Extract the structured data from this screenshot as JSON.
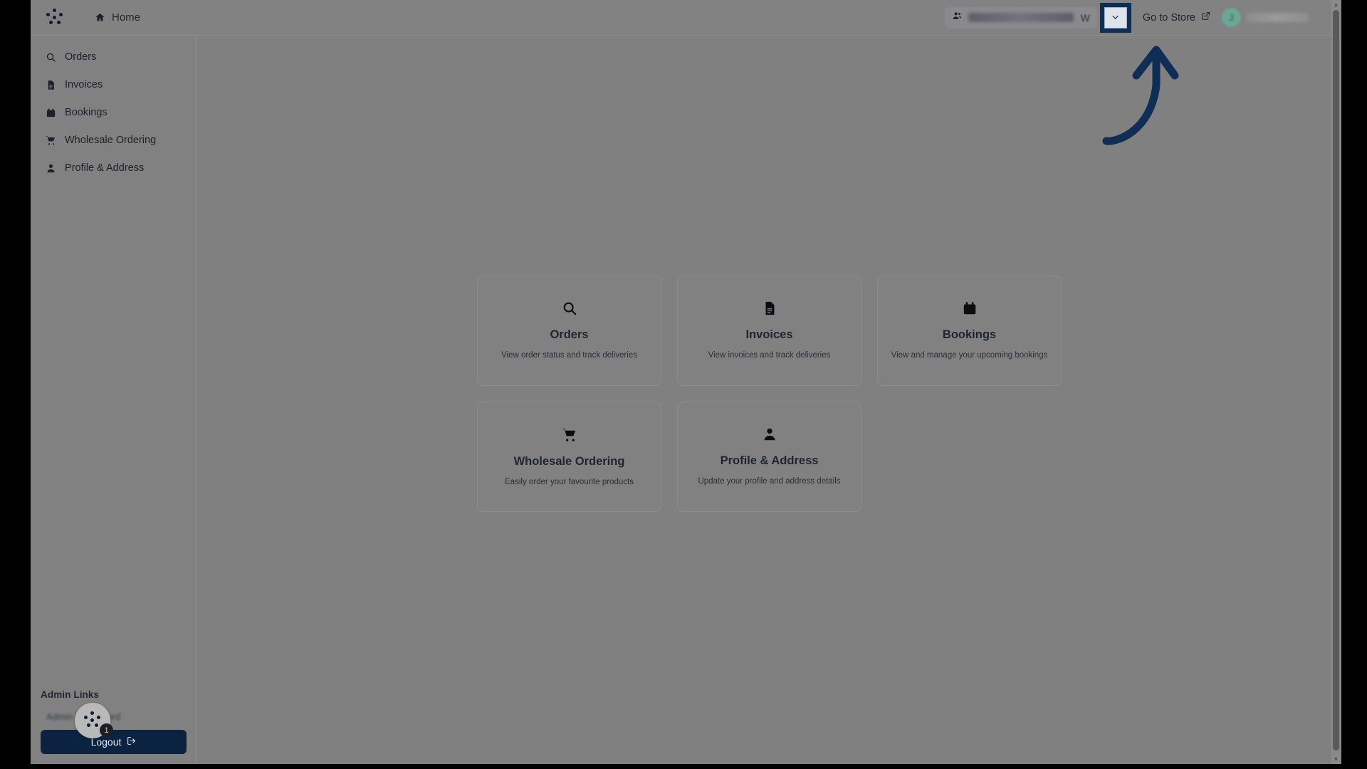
{
  "brand": {
    "logo_icon": "six-dot-logo"
  },
  "topbar": {
    "home_label": "Home",
    "home_icon": "home-icon",
    "customer_selector": {
      "icon": "users-icon",
      "value_redacted": "",
      "value_visible_fragment": "W",
      "dropdown_icon": "chevron-down-icon"
    },
    "store_link_label": "Go to Store",
    "store_link_icon": "external-link-icon",
    "avatar_initial": "J"
  },
  "sidebar": {
    "items": [
      {
        "label": "Orders",
        "icon": "search-icon"
      },
      {
        "label": "Invoices",
        "icon": "document-icon"
      },
      {
        "label": "Bookings",
        "icon": "calendar-icon"
      },
      {
        "label": "Wholesale Ordering",
        "icon": "cart-icon"
      },
      {
        "label": "Profile & Address",
        "icon": "person-icon"
      }
    ],
    "admin": {
      "title": "Admin Links",
      "hidden_link_text": "Admin Dashboard",
      "logout_label": "Logout",
      "logout_icon": "logout-icon"
    }
  },
  "launcher": {
    "icon": "six-dot-logo",
    "badge_count": "1"
  },
  "main": {
    "cards": [
      {
        "title": "Orders",
        "desc": "View order status and track deliveries",
        "icon": "search-icon"
      },
      {
        "title": "Invoices",
        "desc": "View invoices and track deliveries",
        "icon": "document-icon"
      },
      {
        "title": "Bookings",
        "desc": "View and manage your upcoming bookings",
        "icon": "calendar-icon"
      },
      {
        "title": "Wholesale Ordering",
        "desc": "Easily order your favourite products",
        "icon": "cart-icon"
      },
      {
        "title": "Profile & Address",
        "desc": "Update your profile and address details",
        "icon": "person-icon"
      }
    ]
  },
  "annotation": {
    "arrow_icon": "curved-up-arrow",
    "highlight_color": "#0f2e56",
    "target": "customer-selector-dropdown"
  },
  "scrollbar": {
    "up_icon": "caret-up-icon",
    "down_icon": "caret-down-icon"
  }
}
